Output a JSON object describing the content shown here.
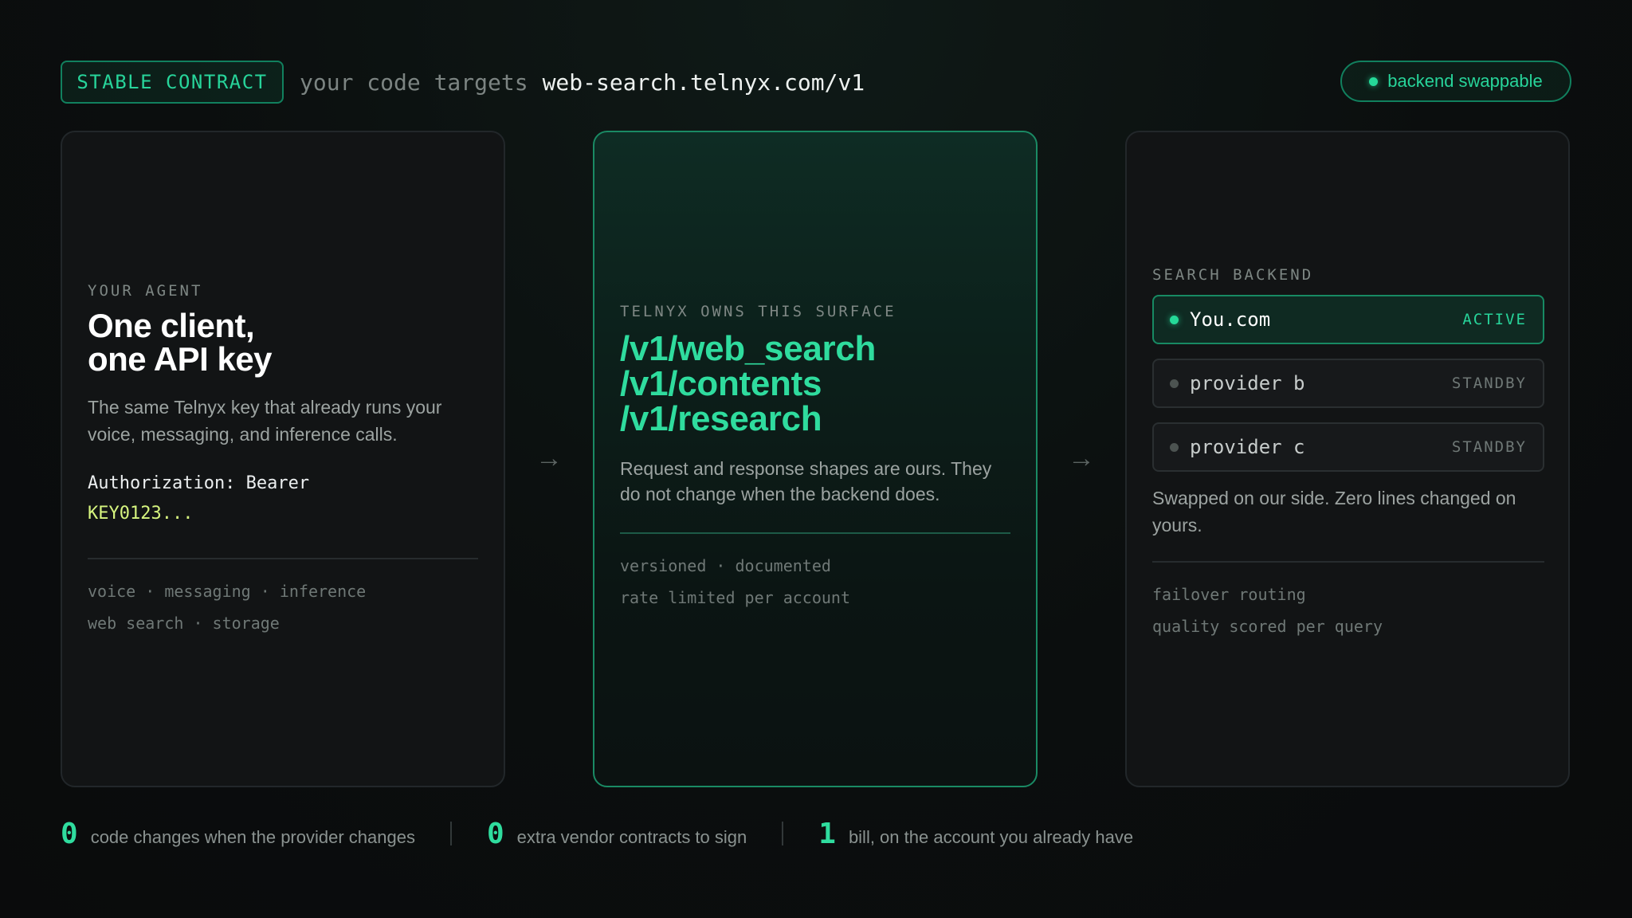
{
  "header": {
    "badge": "STABLE CONTRACT",
    "prefix": "your code targets",
    "url": "web-search.telnyx.com/v1",
    "pill": "backend swappable"
  },
  "left_card": {
    "eyebrow": "YOUR AGENT",
    "title_line1": "One client,",
    "title_line2": "one API key",
    "description": "The same Telnyx key that already runs your voice, messaging, and inference calls.",
    "auth_line1": "Authorization: Bearer",
    "auth_line2": "KEY0123...",
    "tags_line1": "voice · messaging · inference",
    "tags_line2": "web search · storage"
  },
  "mid_card": {
    "eyebrow": "TELNYX OWNS THIS SURFACE",
    "endpoints": [
      "/v1/web_search",
      "/v1/contents",
      "/v1/research"
    ],
    "description": "Request and response shapes are ours. They do not change when the backend does.",
    "tags_line1": "versioned · documented",
    "tags_line2": "rate limited per account"
  },
  "right_card": {
    "eyebrow": "SEARCH BACKEND",
    "providers": [
      {
        "name": "You.com",
        "status": "ACTIVE"
      },
      {
        "name": "provider b",
        "status": "STANDBY"
      },
      {
        "name": "provider c",
        "status": "STANDBY"
      }
    ],
    "description": "Swapped on our side. Zero lines changed on yours.",
    "tags_line1": "failover routing",
    "tags_line2": "quality scored per query"
  },
  "arrow_glyph": "→",
  "stats": [
    {
      "value": "0",
      "label": "code changes when the provider changes"
    },
    {
      "value": "0",
      "label": "extra vendor contracts to sign"
    },
    {
      "value": "1",
      "label": "bill, on the account you already have"
    }
  ],
  "colors": {
    "accent": "#2fdc9e",
    "accent_border": "#11805e",
    "key_text": "#d6f57f",
    "background": "#0a0b0c"
  }
}
